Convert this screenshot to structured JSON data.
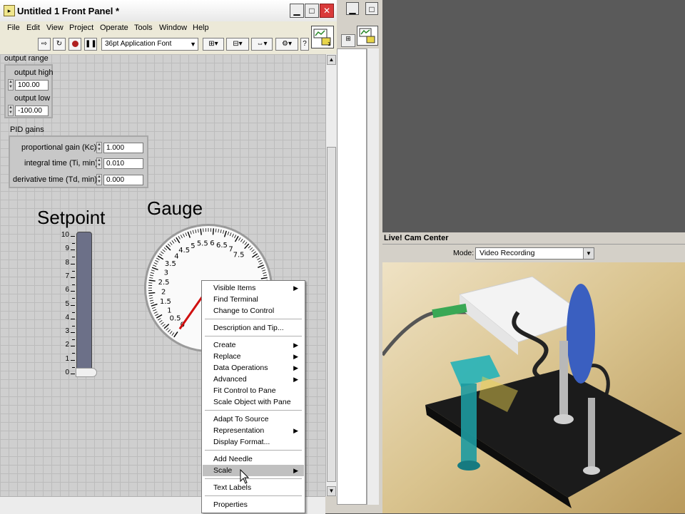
{
  "front_panel": {
    "title": "Untitled 1 Front Panel *",
    "menu": [
      "File",
      "Edit",
      "View",
      "Project",
      "Operate",
      "Tools",
      "Window",
      "Help"
    ],
    "font_selector": "36pt Application Font",
    "output_range": {
      "label": "output range",
      "high_label": "output high",
      "high_value": "100.00",
      "low_label": "output low",
      "low_value": "-100.00"
    },
    "pid_gains": {
      "label": "PID gains",
      "kc_label": "proportional gain (Kc)",
      "kc_value": "1.000",
      "ti_label": "integral time (Ti, min)",
      "ti_value": "0.010",
      "td_label": "derivative time (Td, min)",
      "td_value": "0.000"
    },
    "setpoint": {
      "label": "Setpoint",
      "scale": [
        "10",
        "9",
        "8",
        "7",
        "6",
        "5",
        "4",
        "3",
        "2",
        "1",
        "0"
      ],
      "value": 0
    },
    "gauge": {
      "label": "Gauge",
      "scale": [
        "0",
        "0.5",
        "1",
        "1.5",
        "2",
        "2.5",
        "3",
        "3.5",
        "4",
        "4.5",
        "5",
        "5.5",
        "6",
        "6.5",
        "7",
        "7.5"
      ]
    }
  },
  "context_menu": {
    "items": [
      {
        "label": "Visible Items",
        "submenu": true
      },
      {
        "label": "Find Terminal",
        "submenu": false
      },
      {
        "label": "Change to Control",
        "submenu": false
      },
      {
        "label": "Description and Tip...",
        "submenu": false
      },
      {
        "label": "Create",
        "submenu": true
      },
      {
        "label": "Replace",
        "submenu": true
      },
      {
        "label": "Data Operations",
        "submenu": true
      },
      {
        "label": "Advanced",
        "submenu": true
      },
      {
        "label": "Fit Control to Pane",
        "submenu": false
      },
      {
        "label": "Scale Object with Pane",
        "submenu": false
      },
      {
        "label": "Adapt To Source",
        "submenu": false
      },
      {
        "label": "Representation",
        "submenu": true
      },
      {
        "label": "Display Format...",
        "submenu": false
      },
      {
        "label": "Add Needle",
        "submenu": false
      },
      {
        "label": "Scale",
        "submenu": true,
        "highlighted": true
      },
      {
        "label": "Text Labels",
        "submenu": false
      },
      {
        "label": "Properties",
        "submenu": false
      }
    ]
  },
  "cam_center": {
    "title": "Live! Cam Center",
    "mode_label": "Mode:",
    "mode_value": "Video Recording"
  },
  "colors": {
    "gauge_needle": "#d01010",
    "slider_track": "#6c7088",
    "close_button": "#d93a3a"
  }
}
